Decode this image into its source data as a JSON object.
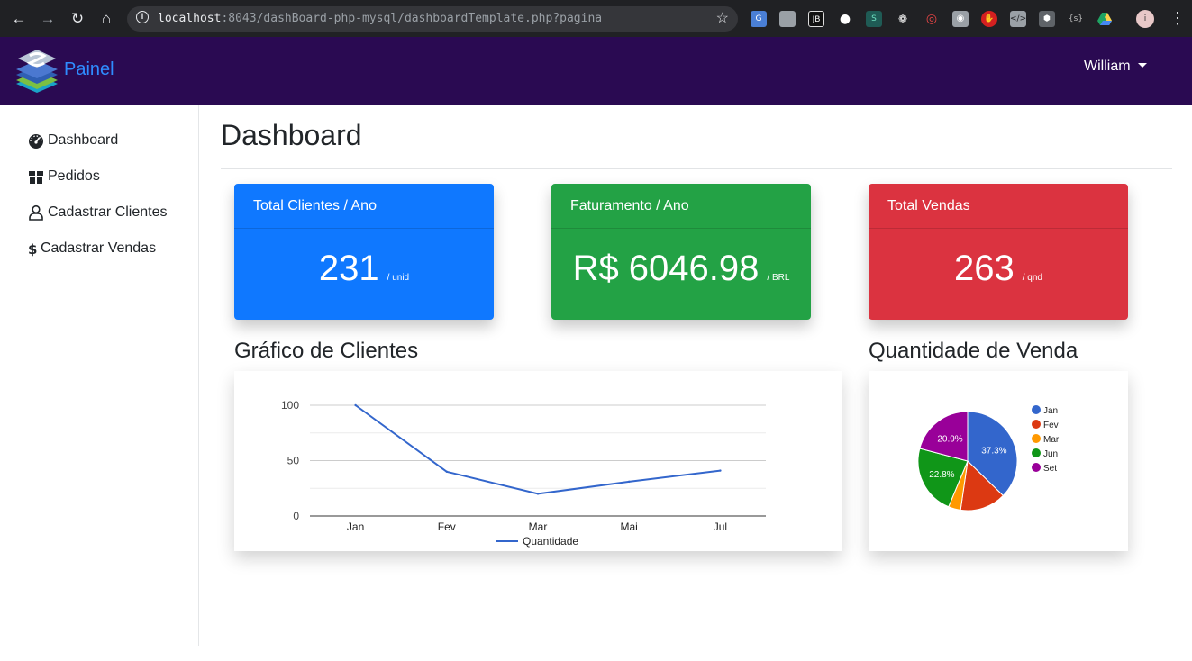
{
  "browser": {
    "url_host": "localhost",
    "url_rest": ":8043/dashBoard-php-mysql/dashboardTemplate.php?pagina"
  },
  "navbar": {
    "brand": "Painel",
    "user": "William"
  },
  "sidebar": {
    "items": [
      {
        "label": "Dashboard",
        "icon": "tachometer-icon"
      },
      {
        "label": "Pedidos",
        "icon": "box-icon"
      },
      {
        "label": "Cadastrar Clientes",
        "icon": "user-icon"
      },
      {
        "label": "Cadastrar Vendas",
        "icon": "dollar-icon"
      }
    ]
  },
  "page": {
    "title": "Dashboard"
  },
  "cards": [
    {
      "title": "Total Clientes / Ano",
      "value": "231",
      "unit": "/ unid",
      "color": "#0f78ff"
    },
    {
      "title": "Faturamento / Ano",
      "value": "R$ 6046.98",
      "unit": "/ BRL",
      "color": "#23a245"
    },
    {
      "title": "Total Vendas",
      "value": "263",
      "unit": "/ qnd",
      "color": "#db3340"
    }
  ],
  "sections": {
    "clientes_title": "Gráfico de Clientes",
    "vendas_title": "Quantidade de Venda"
  },
  "chart_data": [
    {
      "type": "line",
      "categories": [
        "Jan",
        "Fev",
        "Mar",
        "Mai",
        "Jul"
      ],
      "series": [
        {
          "name": "Quantidade",
          "values": [
            100,
            40,
            20,
            31,
            41
          ],
          "color": "#3366cc"
        }
      ],
      "yticks": [
        0,
        50,
        100
      ],
      "ylim": [
        0,
        100
      ],
      "grid": true,
      "legend": "bottom"
    },
    {
      "type": "pie",
      "categories": [
        "Jan",
        "Fev",
        "Mar",
        "Jun",
        "Set"
      ],
      "values": [
        37.3,
        15.0,
        4.0,
        22.8,
        20.9
      ],
      "slice_labels": [
        "37.3%",
        "",
        "",
        "22.8%",
        "20.9%"
      ],
      "colors": [
        "#3366cc",
        "#dc3912",
        "#ff9900",
        "#109618",
        "#990099"
      ],
      "legend": "right"
    }
  ]
}
